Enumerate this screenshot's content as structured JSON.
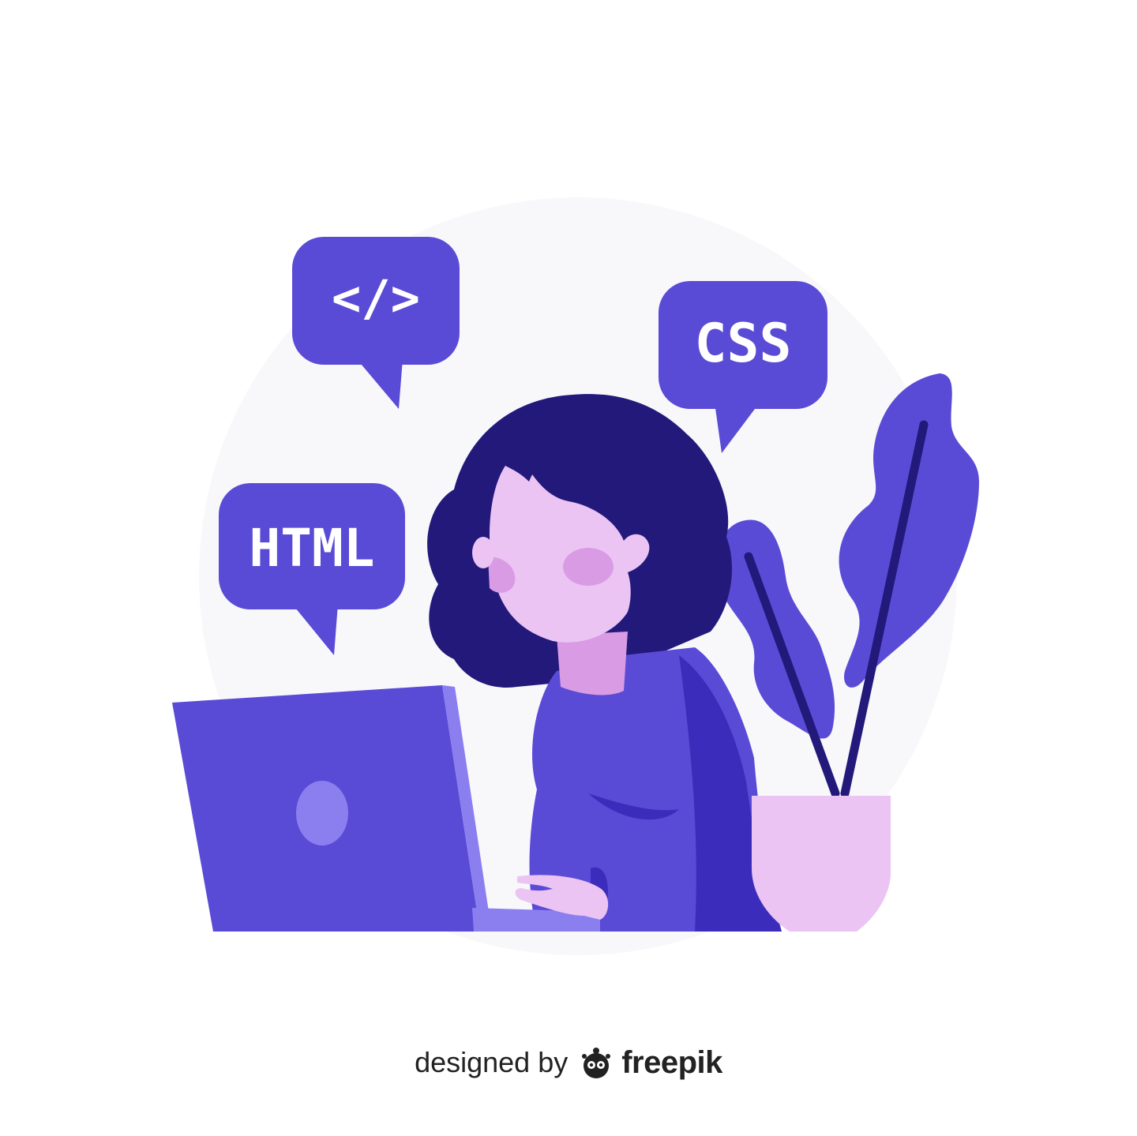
{
  "bubbles": {
    "code": "</>",
    "css": "CSS",
    "html": "HTML"
  },
  "credit": {
    "prefix": "designed by",
    "brand": "freepik"
  },
  "colors": {
    "bubble": "#5a4bd6",
    "hair": "#22197a",
    "skin": "#ebc4f4",
    "cheek": "#d99ce4",
    "sweater": "#5a4bd6",
    "sweater_shadow": "#3b2cbb",
    "laptop": "#5a4bd6",
    "laptop_edge": "#8b7ff0",
    "pot": "#ebc4f4",
    "leaf": "#5a4bd6",
    "stem": "#22197a",
    "backdrop": "#f8f8fb"
  }
}
